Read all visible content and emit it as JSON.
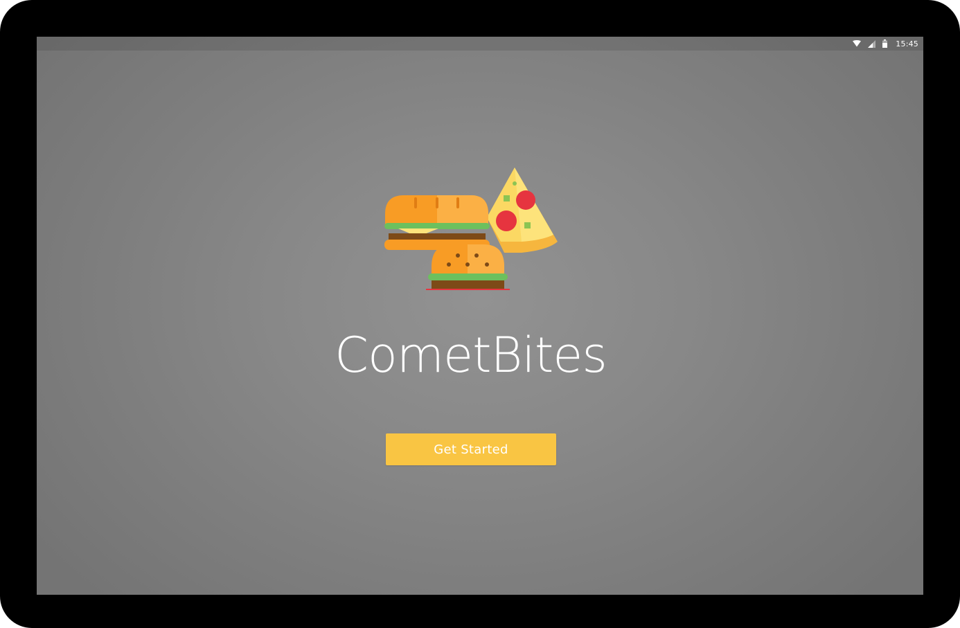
{
  "status_bar": {
    "time": "15:45",
    "icons": [
      "wifi-icon",
      "signal-icon",
      "battery-icon"
    ]
  },
  "logo": {
    "icon": "food-logo-icon",
    "items": [
      "sandwich-icon",
      "pizza-slice-icon",
      "burger-icon"
    ]
  },
  "app": {
    "title": "CometBites"
  },
  "cta": {
    "label": "Get Started",
    "color": "#f9c543"
  },
  "colors": {
    "background": "#8a8a8a",
    "accent": "#f9c543",
    "text": "#ffffff"
  }
}
